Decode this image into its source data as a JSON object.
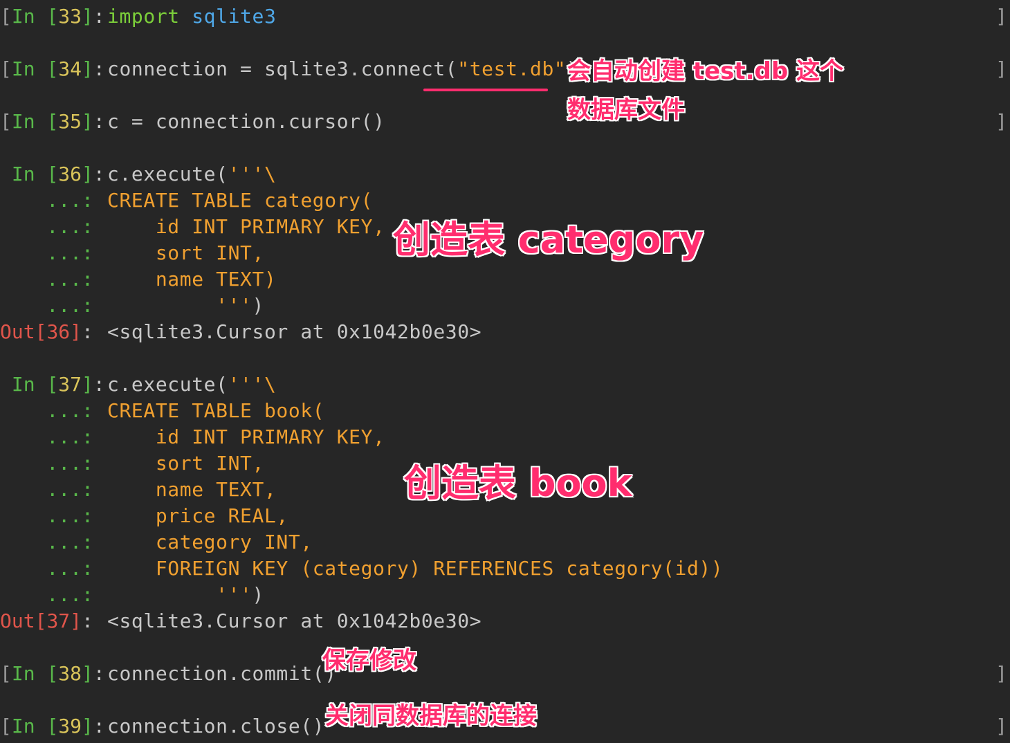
{
  "cells": [
    {
      "id": "33",
      "type": "in",
      "prompt_label": "In ",
      "number": "33",
      "lines": [
        {
          "tokens": [
            {
              "t": "import",
              "c": "kw"
            },
            {
              "t": " ",
              "c": "plain"
            },
            {
              "t": "sqlite3",
              "c": "mod"
            }
          ]
        }
      ],
      "left_bracket": "[",
      "right_bracket": "]"
    },
    {
      "id": "34",
      "type": "in",
      "prompt_label": "In ",
      "number": "34",
      "lines": [
        {
          "tokens": [
            {
              "t": "connection = sqlite3.connect(",
              "c": "plain"
            },
            {
              "t": "\"test.db\"",
              "c": "str"
            },
            {
              "t": ")",
              "c": "plain"
            }
          ]
        }
      ],
      "left_bracket": "[",
      "right_bracket": "]"
    },
    {
      "id": "35",
      "type": "in",
      "prompt_label": "In ",
      "number": "35",
      "lines": [
        {
          "tokens": [
            {
              "t": "c = connection.cursor()",
              "c": "plain"
            }
          ]
        }
      ],
      "left_bracket": "[",
      "right_bracket": "]"
    },
    {
      "id": "36",
      "type": "in",
      "prompt_label": "In ",
      "number": "36",
      "lines": [
        {
          "tokens": [
            {
              "t": "c.execute(",
              "c": "plain"
            },
            {
              "t": "'''\\",
              "c": "str"
            }
          ]
        },
        {
          "tokens": [
            {
              "t": "CREATE TABLE category(",
              "c": "str"
            }
          ]
        },
        {
          "tokens": [
            {
              "t": "    id INT PRIMARY KEY,",
              "c": "str"
            }
          ]
        },
        {
          "tokens": [
            {
              "t": "    sort INT,",
              "c": "str"
            }
          ]
        },
        {
          "tokens": [
            {
              "t": "    name TEXT)",
              "c": "str"
            }
          ]
        },
        {
          "tokens": [
            {
              "t": "         '''",
              "c": "str"
            },
            {
              "t": ")",
              "c": "plain"
            }
          ]
        }
      ],
      "continuation": "...:"
    },
    {
      "id": "out36",
      "type": "out",
      "prompt_label": "Out",
      "number": "36",
      "lines": [
        {
          "tokens": [
            {
              "t": "<sqlite3.Cursor at 0x1042b0e30>",
              "c": "out"
            }
          ]
        }
      ]
    },
    {
      "id": "37",
      "type": "in",
      "prompt_label": "In ",
      "number": "37",
      "lines": [
        {
          "tokens": [
            {
              "t": "c.execute(",
              "c": "plain"
            },
            {
              "t": "'''\\",
              "c": "str"
            }
          ]
        },
        {
          "tokens": [
            {
              "t": "CREATE TABLE book(",
              "c": "str"
            }
          ]
        },
        {
          "tokens": [
            {
              "t": "    id INT PRIMARY KEY,",
              "c": "str"
            }
          ]
        },
        {
          "tokens": [
            {
              "t": "    sort INT,",
              "c": "str"
            }
          ]
        },
        {
          "tokens": [
            {
              "t": "    name TEXT,",
              "c": "str"
            }
          ]
        },
        {
          "tokens": [
            {
              "t": "    price REAL,",
              "c": "str"
            }
          ]
        },
        {
          "tokens": [
            {
              "t": "    category INT,",
              "c": "str"
            }
          ]
        },
        {
          "tokens": [
            {
              "t": "    FOREIGN KEY (category) REFERENCES category(id))",
              "c": "str"
            }
          ]
        },
        {
          "tokens": [
            {
              "t": "         '''",
              "c": "str"
            },
            {
              "t": ")",
              "c": "plain"
            }
          ]
        }
      ],
      "continuation": "...:"
    },
    {
      "id": "out37",
      "type": "out",
      "prompt_label": "Out",
      "number": "37",
      "lines": [
        {
          "tokens": [
            {
              "t": "<sqlite3.Cursor at 0x1042b0e30>",
              "c": "out"
            }
          ]
        }
      ]
    },
    {
      "id": "38",
      "type": "in",
      "prompt_label": "In ",
      "number": "38",
      "lines": [
        {
          "tokens": [
            {
              "t": "connection.commit()",
              "c": "plain"
            }
          ]
        }
      ],
      "left_bracket": "[",
      "right_bracket": "]"
    },
    {
      "id": "39",
      "type": "in",
      "prompt_label": "In ",
      "number": "39",
      "lines": [
        {
          "tokens": [
            {
              "t": "connection.close()",
              "c": "plain"
            }
          ]
        }
      ],
      "left_bracket": "[",
      "right_bracket": "]"
    }
  ],
  "annotations": {
    "connect_note_line1": "会自动创建 test.db 这个",
    "connect_note_line2": "数据库文件",
    "category_note": "创造表 category",
    "book_note": "创造表 book",
    "commit_note": "保存修改",
    "close_note": "关闭同数据库的连接"
  },
  "colors": {
    "background": "#262626",
    "prompt_in": "#59b84a",
    "prompt_number": "#d9c45a",
    "prompt_out": "#e0554b",
    "keyword": "#7ccf3a",
    "module": "#4fa8e8",
    "string": "#f0a030",
    "plain": "#c8c8c8",
    "annotation": "#ff2d6e"
  }
}
